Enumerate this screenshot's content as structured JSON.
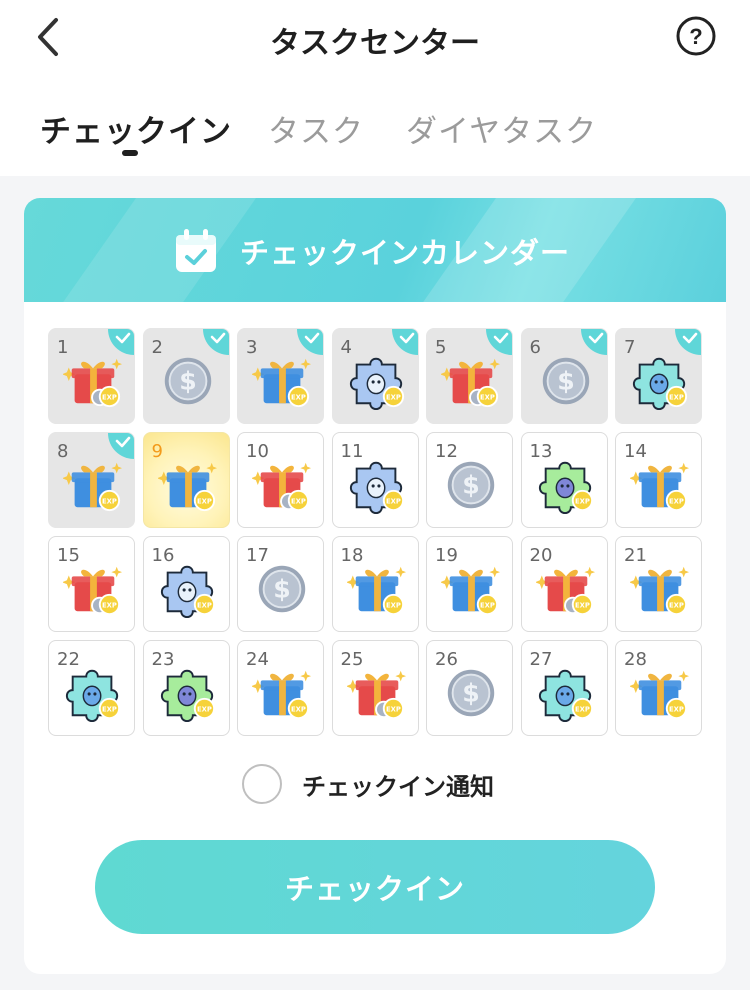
{
  "header": {
    "title": "タスクセンター",
    "back_icon": "chevron-left-icon",
    "help_icon": "question-circle-icon"
  },
  "tabs": [
    {
      "label": "チェックイン",
      "active": true
    },
    {
      "label": "タスク",
      "active": false
    },
    {
      "label": "ダイヤタスク",
      "active": false
    }
  ],
  "calendar": {
    "title": "チェックインカレンダー",
    "icon": "calendar-check-icon",
    "days": [
      {
        "day": "1",
        "reward": "red-gift-coin-exp",
        "checked": true
      },
      {
        "day": "2",
        "reward": "silver-coin",
        "checked": true
      },
      {
        "day": "3",
        "reward": "blue-gift-exp",
        "checked": true
      },
      {
        "day": "4",
        "reward": "blue-puzzle-exp",
        "checked": true
      },
      {
        "day": "5",
        "reward": "red-gift-coin-exp",
        "checked": true
      },
      {
        "day": "6",
        "reward": "silver-coin",
        "checked": true
      },
      {
        "day": "7",
        "reward": "teal-puzzle-exp",
        "checked": true
      },
      {
        "day": "8",
        "reward": "blue-gift-exp",
        "checked": true
      },
      {
        "day": "9",
        "reward": "blue-gift-exp",
        "checked": false,
        "today": true
      },
      {
        "day": "10",
        "reward": "red-gift-coin-exp",
        "checked": false
      },
      {
        "day": "11",
        "reward": "blue-puzzle-exp",
        "checked": false
      },
      {
        "day": "12",
        "reward": "silver-coin",
        "checked": false
      },
      {
        "day": "13",
        "reward": "green-puzzle-exp",
        "checked": false
      },
      {
        "day": "14",
        "reward": "blue-gift-exp",
        "checked": false
      },
      {
        "day": "15",
        "reward": "red-gift-coin-exp",
        "checked": false
      },
      {
        "day": "16",
        "reward": "blue-puzzle-exp",
        "checked": false
      },
      {
        "day": "17",
        "reward": "silver-coin",
        "checked": false
      },
      {
        "day": "18",
        "reward": "blue-gift-exp",
        "checked": false
      },
      {
        "day": "19",
        "reward": "blue-gift-exp",
        "checked": false
      },
      {
        "day": "20",
        "reward": "red-gift-coin-exp",
        "checked": false
      },
      {
        "day": "21",
        "reward": "blue-gift-exp",
        "checked": false
      },
      {
        "day": "22",
        "reward": "teal-puzzle-exp",
        "checked": false
      },
      {
        "day": "23",
        "reward": "green-puzzle-exp",
        "checked": false
      },
      {
        "day": "24",
        "reward": "blue-gift-exp",
        "checked": false
      },
      {
        "day": "25",
        "reward": "red-gift-coin-exp",
        "checked": false
      },
      {
        "day": "26",
        "reward": "silver-coin",
        "checked": false
      },
      {
        "day": "27",
        "reward": "teal-puzzle-exp",
        "checked": false
      },
      {
        "day": "28",
        "reward": "blue-gift-exp",
        "checked": false
      }
    ]
  },
  "notify": {
    "label": "チェックイン通知",
    "checked": false
  },
  "cta": {
    "label": "チェックイン"
  },
  "colors": {
    "accent": "#5fd6d8",
    "check": "#5fd6d8",
    "today_number": "#f39a1a"
  }
}
